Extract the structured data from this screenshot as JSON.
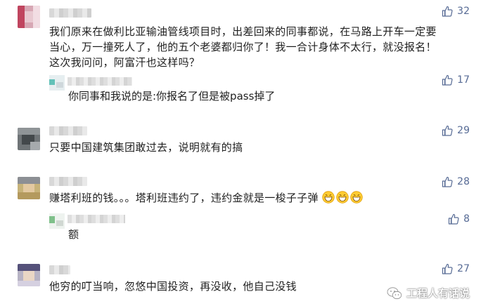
{
  "accent_color": "#576b95",
  "comments": [
    {
      "text_lines": [
        "我们原来在做利比亚输油管线项目时，出差回来的同事都说，在马路上开车一定要",
        "当心，万一撞死人了，他的五个老婆都归你了！我一合计身体不太行，就没报名！",
        "这次我问问，阿富汗也这样吗？"
      ],
      "likes": "32"
    },
    {
      "reply_text": "你同事和我说的是:你报名了但是被pass掉了",
      "likes": "17"
    },
    {
      "text_lines": [
        "只要中国建筑集团敢过去，说明就有的搞"
      ],
      "likes": "29"
    },
    {
      "text_lines": [
        "赚塔利班的钱。。。塔利班违约了，违约金就是一梭子子弹"
      ],
      "emoji": "grin-icon",
      "likes": "28"
    },
    {
      "reply_text": "额",
      "likes": "8"
    },
    {
      "text_lines": [
        "他穷的叮当响，忽悠中国投资，再没收，他自己没钱"
      ],
      "likes": "27"
    }
  ],
  "watermark": {
    "text": "工程人有话说",
    "icon": "wechat-icon"
  }
}
